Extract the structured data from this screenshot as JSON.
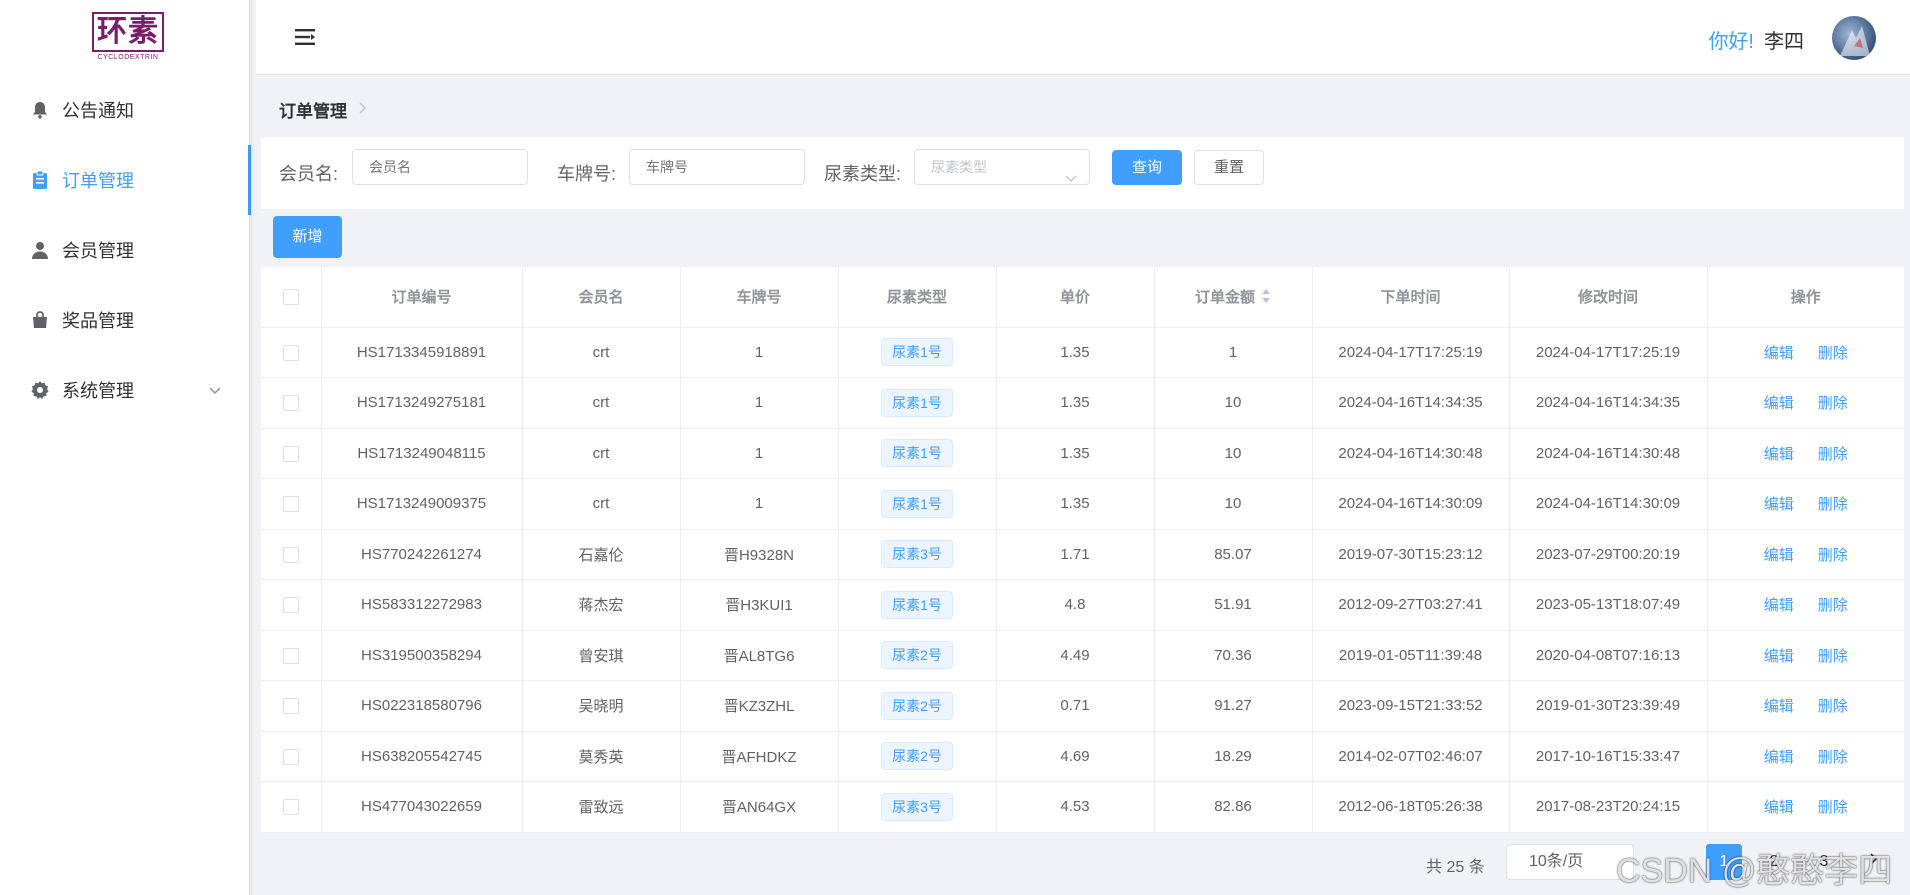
{
  "logo": {
    "main": "环素",
    "sub": "CYCLODEXTRIN"
  },
  "sidebar": {
    "items": [
      {
        "label": "公告通知",
        "icon": "bell-icon"
      },
      {
        "label": "订单管理",
        "icon": "clipboard-icon",
        "active": true
      },
      {
        "label": "会员管理",
        "icon": "user-icon"
      },
      {
        "label": "奖品管理",
        "icon": "shopping-bag-icon"
      },
      {
        "label": "系统管理",
        "icon": "gear-icon"
      }
    ]
  },
  "header": {
    "greeting": "你好!",
    "username": "李四"
  },
  "breadcrumb": {
    "current": "订单管理"
  },
  "search": {
    "member_label": "会员名:",
    "member_placeholder": "会员名",
    "plate_label": "车牌号:",
    "plate_placeholder": "车牌号",
    "type_label": "尿素类型:",
    "type_placeholder": "尿素类型",
    "query_button": "查询",
    "reset_button": "重置"
  },
  "add_button": "新增",
  "table": {
    "headers": [
      "订单编号",
      "会员名",
      "车牌号",
      "尿素类型",
      "单价",
      "订单金额",
      "下单时间",
      "修改时间",
      "操作"
    ],
    "edit_label": "编辑",
    "delete_label": "删除",
    "rows": [
      [
        "HS1713345918891",
        "crt",
        "1",
        "尿素1号",
        "1.35",
        "1",
        "2024-04-17T17:25:19",
        "2024-04-17T17:25:19"
      ],
      [
        "HS1713249275181",
        "crt",
        "1",
        "尿素1号",
        "1.35",
        "10",
        "2024-04-16T14:34:35",
        "2024-04-16T14:34:35"
      ],
      [
        "HS1713249048115",
        "crt",
        "1",
        "尿素1号",
        "1.35",
        "10",
        "2024-04-16T14:30:48",
        "2024-04-16T14:30:48"
      ],
      [
        "HS1713249009375",
        "crt",
        "1",
        "尿素1号",
        "1.35",
        "10",
        "2024-04-16T14:30:09",
        "2024-04-16T14:30:09"
      ],
      [
        "HS770242261274",
        "石嘉伦",
        "晋H9328N",
        "尿素3号",
        "1.71",
        "85.07",
        "2019-07-30T15:23:12",
        "2023-07-29T00:20:19"
      ],
      [
        "HS583312272983",
        "蒋杰宏",
        "晋H3KUI1",
        "尿素1号",
        "4.8",
        "51.91",
        "2012-09-27T03:27:41",
        "2023-05-13T18:07:49"
      ],
      [
        "HS319500358294",
        "曾安琪",
        "晋AL8TG6",
        "尿素2号",
        "4.49",
        "70.36",
        "2019-01-05T11:39:48",
        "2020-04-08T07:16:13"
      ],
      [
        "HS022318580796",
        "吴晓明",
        "晋KZ3ZHL",
        "尿素2号",
        "0.71",
        "91.27",
        "2023-09-15T21:33:52",
        "2019-01-30T23:39:49"
      ],
      [
        "HS638205542745",
        "莫秀英",
        "晋AFHDKZ",
        "尿素2号",
        "4.69",
        "18.29",
        "2014-02-07T02:46:07",
        "2017-10-16T15:33:47"
      ],
      [
        "HS477043022659",
        "雷致远",
        "晋AN64GX",
        "尿素3号",
        "4.53",
        "82.86",
        "2012-06-18T05:26:38",
        "2017-08-23T20:24:15"
      ]
    ]
  },
  "pagination": {
    "total": "共 25 条",
    "page_size": "10条/页",
    "pages": [
      "1",
      "2",
      "3"
    ]
  },
  "watermark": "CSDN @憨憨李四",
  "colors": {
    "accent": "#409eff",
    "brand": "#7a1d6b"
  }
}
